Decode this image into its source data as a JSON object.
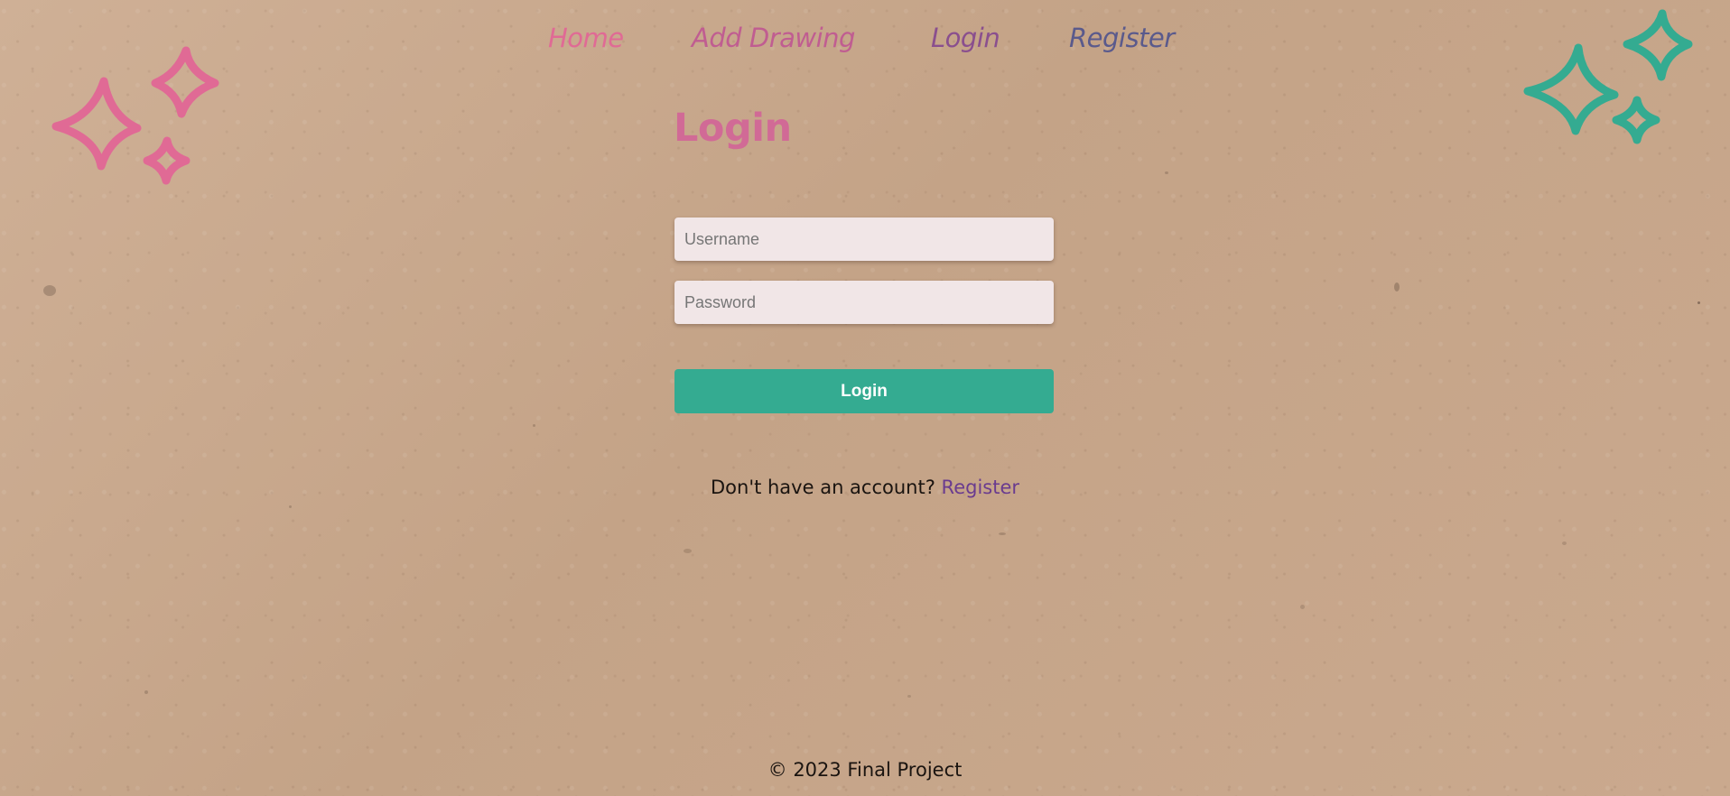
{
  "nav": {
    "home": "Home",
    "add_drawing": "Add Drawing",
    "login": "Login",
    "register": "Register"
  },
  "main": {
    "title": "Login",
    "username": {
      "value": "",
      "placeholder": "Username"
    },
    "password": {
      "value": "",
      "placeholder": "Password"
    },
    "submit_label": "Login",
    "prompt_text": "Don't have an account?",
    "register_link": "Register"
  },
  "footer": {
    "text": "© 2023 Final Project"
  },
  "colors": {
    "pink_accent": "#e06a95",
    "teal_accent": "#34ab91",
    "purple_link": "#6a3b8f",
    "background": "#c8a88d"
  },
  "icons": [
    "sparkles-icon",
    "sparkles-icon"
  ]
}
